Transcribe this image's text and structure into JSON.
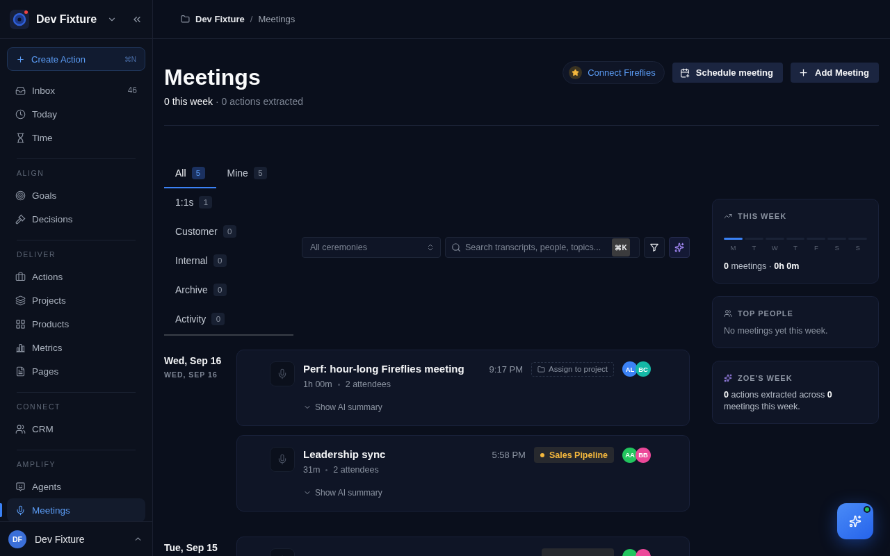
{
  "sidebar": {
    "workspace": {
      "name": "Dev Fixture",
      "notification": true
    },
    "create_action": {
      "label": "Create Action",
      "shortcut": "⌘N"
    },
    "sections": [
      {
        "items": [
          {
            "kind": "inbox",
            "label": "Inbox",
            "count": "46",
            "selected": false
          },
          {
            "kind": "clock",
            "label": "Today",
            "selected": false
          },
          {
            "kind": "hourglass",
            "label": "Time",
            "selected": false
          }
        ]
      },
      {
        "heading": "ALIGN",
        "items": [
          {
            "kind": "target",
            "label": "Goals",
            "selected": false
          },
          {
            "kind": "gavel",
            "label": "Decisions",
            "selected": false
          }
        ]
      },
      {
        "heading": "DELIVER",
        "items": [
          {
            "kind": "briefcase",
            "label": "Actions",
            "selected": false
          },
          {
            "kind": "layers",
            "label": "Projects",
            "selected": false
          },
          {
            "kind": "grid",
            "label": "Products",
            "selected": false
          },
          {
            "kind": "chart",
            "label": "Metrics",
            "selected": false
          },
          {
            "kind": "file",
            "label": "Pages",
            "selected": false
          }
        ]
      },
      {
        "heading": "CONNECT",
        "items": [
          {
            "kind": "users",
            "label": "CRM",
            "selected": false
          }
        ]
      },
      {
        "heading": "AMPLIFY",
        "items": [
          {
            "kind": "bot",
            "label": "Agents",
            "selected": false
          },
          {
            "kind": "mic",
            "label": "Meetings",
            "selected": true
          }
        ]
      }
    ],
    "user": {
      "initials": "DF",
      "name": "Dev Fixture"
    }
  },
  "breadcrumb": {
    "items": [
      {
        "kind": "workspace",
        "label": "Dev Fixture"
      },
      {
        "kind": "page",
        "label": "Meetings"
      }
    ],
    "separator": "/"
  },
  "header": {
    "title": "Meetings",
    "summary": "**0 this week** · 0 actions extracted",
    "actions": [
      {
        "kind": "integration",
        "label": "Connect Fireflies"
      },
      {
        "kind": "schedule",
        "label": "Schedule meeting"
      },
      {
        "kind": "add",
        "label": "Add Meeting"
      }
    ]
  },
  "tabs": [
    {
      "label": "All",
      "count": "5",
      "selected": true
    },
    {
      "label": "Mine",
      "count": "5",
      "selected": false
    },
    {
      "label": "1:1s",
      "count": "1",
      "selected": false
    },
    {
      "label": "Customer",
      "count": "0",
      "selected": false
    },
    {
      "label": "Internal",
      "count": "0",
      "selected": false
    },
    {
      "label": "Archive",
      "count": "0",
      "selected": false
    },
    {
      "label": "Activity",
      "count": "0",
      "selected": false
    }
  ],
  "filters": {
    "ceremony": {
      "value": "All ceremonies"
    },
    "search": {
      "placeholder": "Search transcripts, people, topics...",
      "shortcut": "⌘K"
    }
  },
  "meeting_groups": [
    {
      "date": "Wed, Sep 16",
      "date_caption": "WED, SEP 16",
      "meetings": [
        {
          "title": "Perf: hour-long Fireflies meeting",
          "duration": "1h 00m",
          "attendees": "2 attendees",
          "time": "9:17 PM",
          "tag": {
            "kind": "assign",
            "label": "Assign to project"
          },
          "avatars": [
            {
              "initials": "AL",
              "color": "#3b82f6"
            },
            {
              "initials": "BC",
              "color": "#14b8a6"
            }
          ],
          "summary_toggle": {
            "label": "Show AI summary",
            "expanded": false
          }
        },
        {
          "title": "Leadership sync",
          "duration": "31m",
          "attendees": "2 attendees",
          "time": "5:58 PM",
          "tag": {
            "kind": "project",
            "label": "Sales Pipeline",
            "color": "#f5b83d"
          },
          "avatars": [
            {
              "initials": "AA",
              "color": "#22c55e"
            },
            {
              "initials": "BB",
              "color": "#ec4899"
            }
          ],
          "summary_toggle": {
            "label": "Show AI summary",
            "expanded": false
          }
        }
      ]
    },
    {
      "date": "Tue, Sep 15",
      "meetings": [
        {
          "tag": {
            "kind": "project"
          },
          "avatars": [
            {
              "color": "#22c55e"
            },
            {
              "color": "#ec4899"
            }
          ]
        }
      ]
    }
  ],
  "this_week": {
    "title": "THIS WEEK",
    "days": [
      {
        "label": "M",
        "current": true
      },
      {
        "label": "T",
        "current": false
      },
      {
        "label": "W",
        "current": false
      },
      {
        "label": "T",
        "current": false
      },
      {
        "label": "F",
        "current": false
      },
      {
        "label": "S",
        "current": false
      },
      {
        "label": "S",
        "current": false
      }
    ],
    "summary": "**0** meetings · **0h 0m**"
  },
  "top_people": {
    "title": "TOP PEOPLE",
    "empty_text": "No meetings yet this week."
  },
  "zoe_week": {
    "title": "ZOE'S WEEK",
    "text": "**0** actions extracted across **0** meetings this week."
  },
  "assistant_button": {
    "online": true
  }
}
